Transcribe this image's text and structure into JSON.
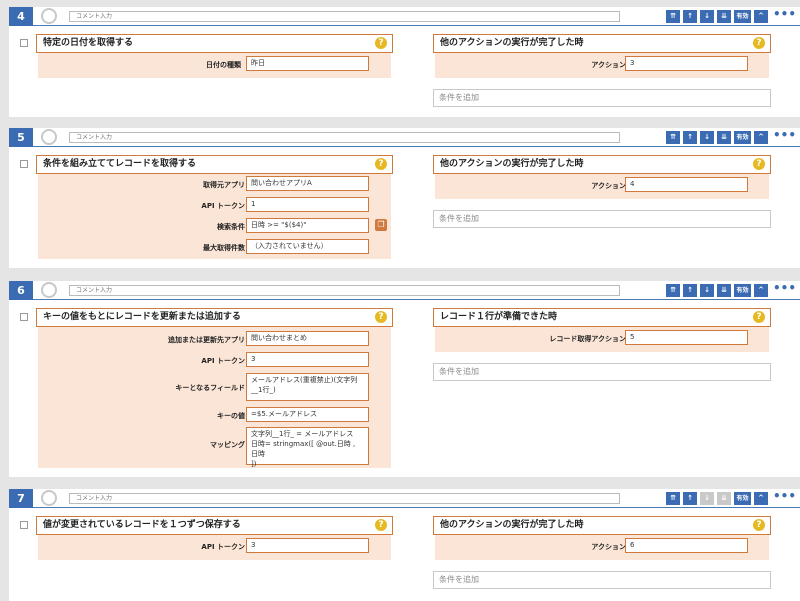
{
  "comment_placeholder": "コメント入力",
  "toolbar": {
    "move_top": "⇈",
    "move_up": "↑",
    "move_down": "↓",
    "move_bottom": "⇊",
    "enabled": "有効",
    "collapse": "^",
    "more": "•••"
  },
  "add_condition": "条件を追加",
  "steps": [
    {
      "number": "4",
      "action_title": "特定の日付を取得する",
      "fields": [
        {
          "label": "日付の種類",
          "value": "昨日"
        }
      ],
      "trigger_title": "他のアクションの実行が完了した時",
      "trigger_fields": [
        {
          "label": "アクション",
          "value": "3"
        }
      ]
    },
    {
      "number": "5",
      "action_title": "条件を組み立ててレコードを取得する",
      "fields": [
        {
          "label": "取得元アプリ",
          "value": "問い合わせアプリA"
        },
        {
          "label": "API トークン",
          "value": "1"
        },
        {
          "label": "検索条件",
          "value": "日時 >= \"$($4)\""
        },
        {
          "label": "最大取得件数",
          "value": "（入力されていません）"
        }
      ],
      "trigger_title": "他のアクションの実行が完了した時",
      "trigger_fields": [
        {
          "label": "アクション",
          "value": "4"
        }
      ]
    },
    {
      "number": "6",
      "action_title": "キーの値をもとにレコードを更新または追加する",
      "fields": [
        {
          "label": "追加または更新先アプリ",
          "value": "問い合わせまとめ"
        },
        {
          "label": "API トークン",
          "value": "3"
        },
        {
          "label": "キーとなるフィールド",
          "value_lines": [
            "メールアドレス(重複禁止)(文字列",
            "__1行_)"
          ]
        },
        {
          "label": "キーの値",
          "value": "=$5.メールアドレス"
        },
        {
          "label": "マッピング",
          "value_lines": [
            "文字列__1行_ = メールアドレス",
            "日時= stringmax([ @out.日時 , 日時",
            "])"
          ]
        }
      ],
      "trigger_title": "レコード１行が準備できた時",
      "trigger_fields": [
        {
          "label": "レコード取得アクション",
          "value": "5"
        }
      ]
    },
    {
      "number": "7",
      "action_title": "値が変更されているレコードを１つずつ保存する",
      "fields": [
        {
          "label": "API トークン",
          "value": "3"
        }
      ],
      "trigger_title": "他のアクションの実行が完了した時",
      "trigger_fields": [
        {
          "label": "アクション",
          "value": "6"
        }
      ]
    }
  ]
}
